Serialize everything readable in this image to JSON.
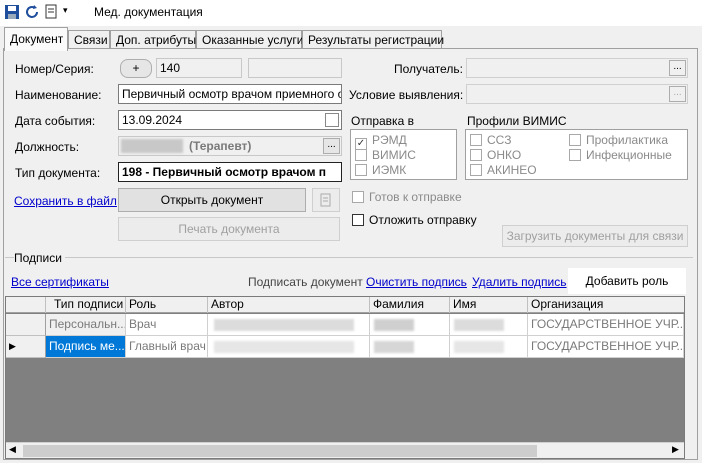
{
  "window": {
    "title": "Мед. документация"
  },
  "tabs": [
    {
      "label": "Документ"
    },
    {
      "label": "Связи"
    },
    {
      "label": "Доп. атрибуты"
    },
    {
      "label": "Оказанные услуги"
    },
    {
      "label": "Результаты регистрации"
    }
  ],
  "form": {
    "number_label": "Номер/Серия:",
    "number_plus": "+",
    "number_value": "140",
    "name_label": "Наименование:",
    "name_value": "Первичный осмотр врачом приемного отде",
    "event_date_label": "Дата события:",
    "event_date_value": "13.09.2024",
    "position_label": "Должность:",
    "position_value": "(Терапевт)",
    "doc_type_label": "Тип документа:",
    "doc_type_value": "198 - Первичный осмотр врачом п",
    "recipient_label": "Получатель:",
    "condition_label": "Условие выявления:",
    "ellipsis": "..."
  },
  "actions": {
    "save_link": "Сохранить в файл",
    "open_doc": "Открыть документ",
    "print_doc": "Печать документа",
    "load_docs": "Загрузить документы для связи"
  },
  "sending": {
    "title": "Отправка в",
    "items": [
      {
        "label": "РЭМД",
        "checked": true
      },
      {
        "label": "ВИМИС",
        "checked": false
      },
      {
        "label": "ИЭМК",
        "checked": false
      }
    ]
  },
  "vimis": {
    "title": "Профили ВИМИС",
    "items": [
      {
        "label": "ССЗ"
      },
      {
        "label": "ОНКО"
      },
      {
        "label": "АКИНЕО"
      },
      {
        "label": "Профилактика"
      },
      {
        "label": "Инфекционные"
      }
    ]
  },
  "ready_label": "Готов к отправке",
  "postpone_label": "Отложить отправку",
  "signatures": {
    "title": "Подписи",
    "all_certs": "Все сертификаты",
    "sign_doc": "Подписать документ",
    "clear_sign": "Очистить подпись",
    "delete_sign": "Удалить подпись",
    "add_role": "Добавить роль",
    "columns": [
      "Тип подписи",
      "Роль",
      "Автор",
      "Фамилия",
      "Имя",
      "Организация"
    ],
    "rows": [
      {
        "type": "Персональн...",
        "role": "Врач",
        "org": "ГОСУДАРСТВЕННОЕ УЧР..."
      },
      {
        "type": "Подпись ме...",
        "role": "Главный врач",
        "org": "ГОСУДАРСТВЕННОЕ УЧР..."
      }
    ]
  }
}
